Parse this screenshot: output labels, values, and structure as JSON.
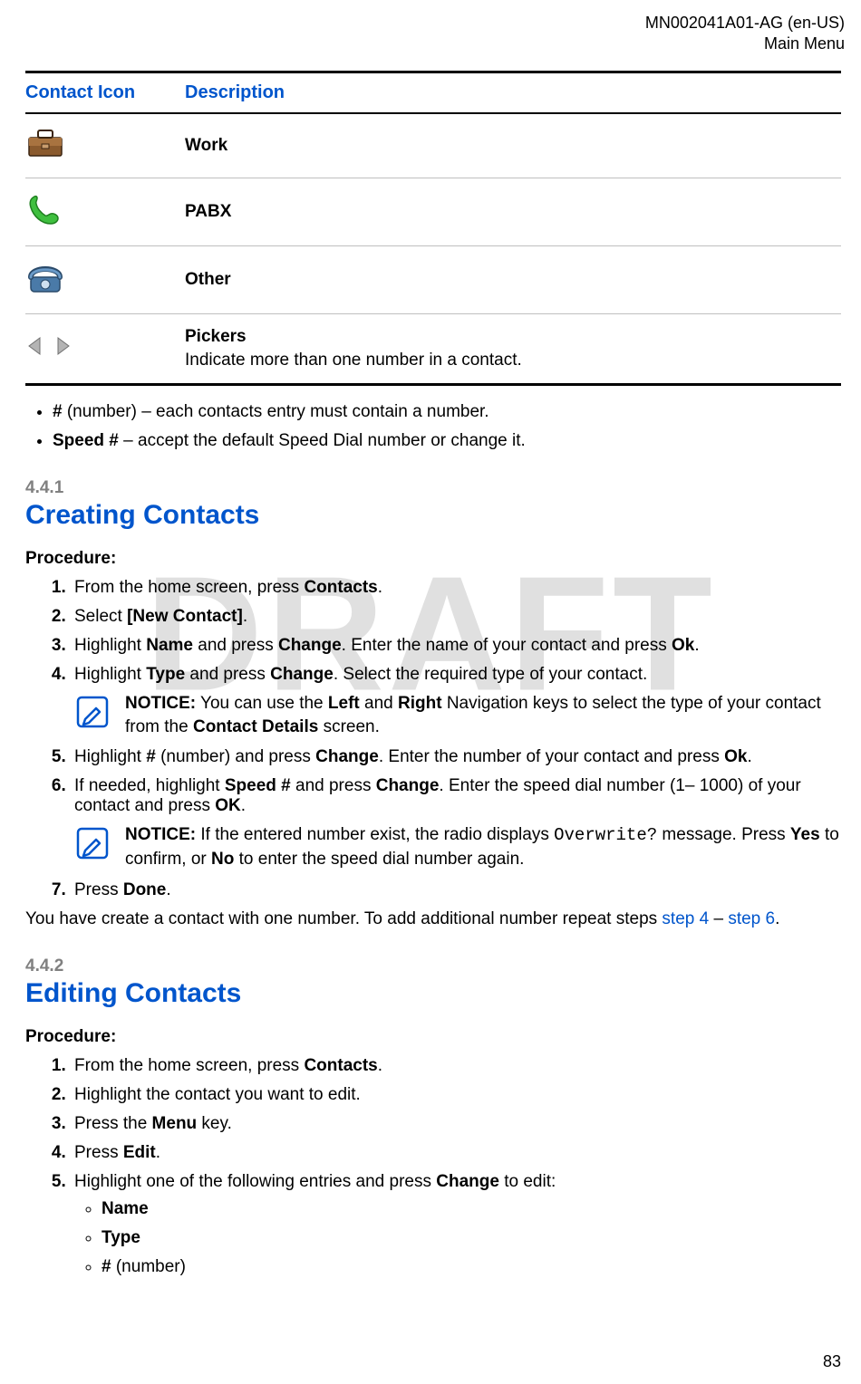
{
  "meta": {
    "doc_id": "MN002041A01-AG (en-US)",
    "section": "Main Menu",
    "page_num": "83",
    "watermark": "DRAFT"
  },
  "table": {
    "headers": {
      "icon": "Contact Icon",
      "desc": "Description"
    },
    "rows": [
      {
        "title": "Work",
        "desc": ""
      },
      {
        "title": "PABX",
        "desc": ""
      },
      {
        "title": "Other",
        "desc": ""
      },
      {
        "title": "Pickers",
        "desc": "Indicate more than one number in a contact."
      }
    ]
  },
  "bullets": [
    {
      "b": "#",
      "after": " (number) – each contacts entry must contain a number."
    },
    {
      "b": "Speed #",
      "after": " – accept the default Speed Dial number or change it."
    }
  ],
  "sec441": {
    "num": "4.4.1",
    "title": "Creating Contacts",
    "proc_label": "Procedure:",
    "steps": {
      "s1": {
        "pre": "From the home screen, press ",
        "b1": "Contacts",
        "post": "."
      },
      "s2": {
        "pre": "Select ",
        "b1": "[New Contact]",
        "post": "."
      },
      "s3": {
        "pre": "Highlight ",
        "b1": "Name",
        "mid1": " and press ",
        "b2": "Change",
        "mid2": ". Enter the name of your contact and press ",
        "b3": "Ok",
        "post": "."
      },
      "s4": {
        "pre": "Highlight ",
        "b1": "Type",
        "mid1": " and press ",
        "b2": "Change",
        "post": ". Select the required type of your contact.",
        "notice_label": "NOTICE:",
        "notice_pre": " You can use the ",
        "notice_b1": "Left",
        "notice_mid1": " and ",
        "notice_b2": "Right",
        "notice_mid2": " Navigation keys to select the type of your contact from the ",
        "notice_b3": "Contact Details",
        "notice_post": " screen."
      },
      "s5": {
        "pre": "Highlight ",
        "b1": "#",
        "mid1": " (number) and press ",
        "b2": "Change",
        "mid2": ". Enter the number of your contact and press ",
        "b3": "Ok",
        "post": "."
      },
      "s6": {
        "pre": "If needed, highlight ",
        "b1": "Speed #",
        "mid1": " and press ",
        "b2": "Change",
        "mid2": ". Enter the speed dial number (1– 1000) of your contact and press ",
        "b3": "OK",
        "post": ".",
        "notice_label": "NOTICE:",
        "notice_pre": " If the entered number exist, the radio displays ",
        "notice_code": "Overwrite?",
        "notice_mid1": " message. Press ",
        "notice_b1": "Yes",
        "notice_mid2": " to confirm, or ",
        "notice_b2": "No",
        "notice_post": " to enter the speed dial number again."
      },
      "s7": {
        "pre": "Press ",
        "b1": "Done",
        "post": "."
      }
    },
    "tail_pre": "You have create a contact with one number. To add additional number repeat steps ",
    "tail_link1": "step 4",
    "tail_mid": " – ",
    "tail_link2": "step 6",
    "tail_post": "."
  },
  "sec442": {
    "num": "4.4.2",
    "title": "Editing Contacts",
    "proc_label": "Procedure:",
    "steps": {
      "s1": {
        "pre": "From the home screen, press ",
        "b1": "Contacts",
        "post": "."
      },
      "s2": {
        "text": "Highlight the contact you want to edit."
      },
      "s3": {
        "pre": "Press the ",
        "b1": "Menu",
        "post": " key."
      },
      "s4": {
        "pre": "Press ",
        "b1": "Edit",
        "post": "."
      },
      "s5": {
        "pre": "Highlight one of the following entries and press ",
        "b1": "Change",
        "post": " to edit:",
        "sub1": "Name",
        "sub2": "Type",
        "sub3_b": "#",
        "sub3_after": " (number)"
      }
    }
  }
}
